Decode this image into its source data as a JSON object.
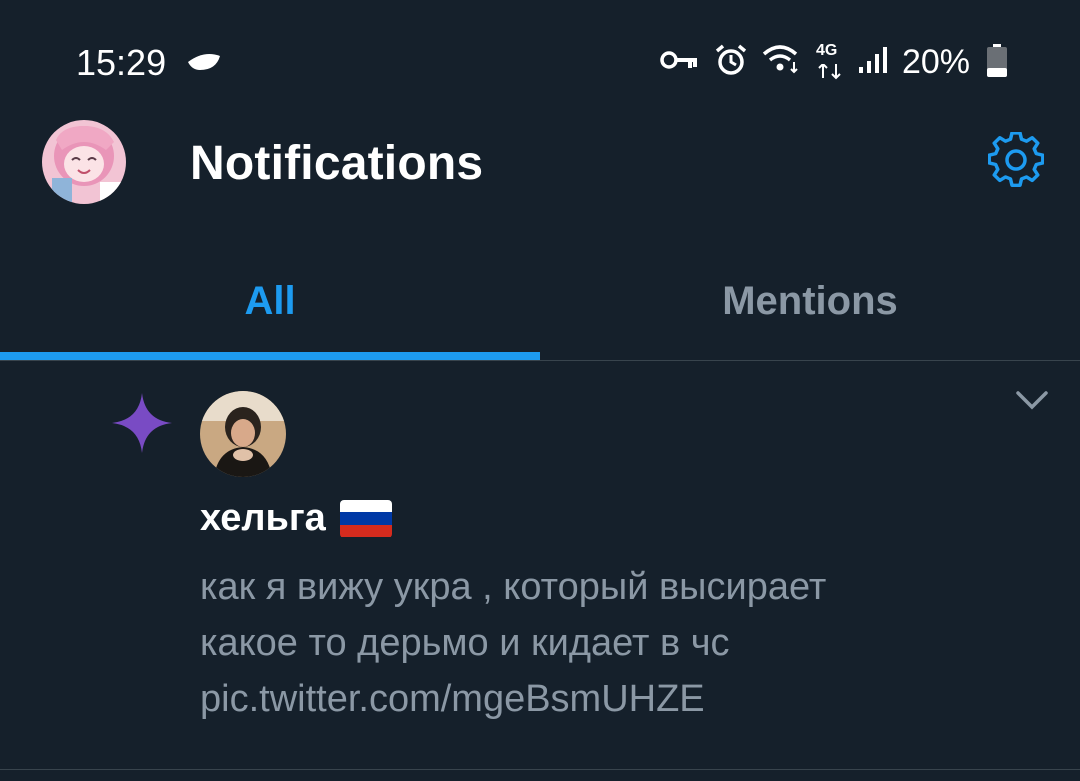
{
  "status_bar": {
    "time": "15:29",
    "network": "4G",
    "battery": "20%",
    "icons": [
      "cloud-icon",
      "key-icon",
      "alarm-icon",
      "wifi-icon",
      "network-4g-icon",
      "signal-icon",
      "battery-icon"
    ]
  },
  "header": {
    "title": "Notifications",
    "settings_icon": "gear-icon"
  },
  "tabs": [
    {
      "label": "All",
      "active": true
    },
    {
      "label": "Mentions",
      "active": false
    }
  ],
  "notification": {
    "type_icon": "sparkle-icon",
    "user_name": "хельга",
    "flag": "russia-flag-icon",
    "text_lines": [
      "как я вижу укра , который высирает",
      "какое то дерьмо и кидает в чс",
      "pic.twitter.com/mgeBsmUHZE"
    ],
    "more_icon": "chevron-down-icon"
  },
  "colors": {
    "background": "#15202b",
    "accent": "#1d9bf0",
    "muted": "#8b98a5",
    "sparkle": "#794bc4",
    "divider": "#38444d"
  }
}
